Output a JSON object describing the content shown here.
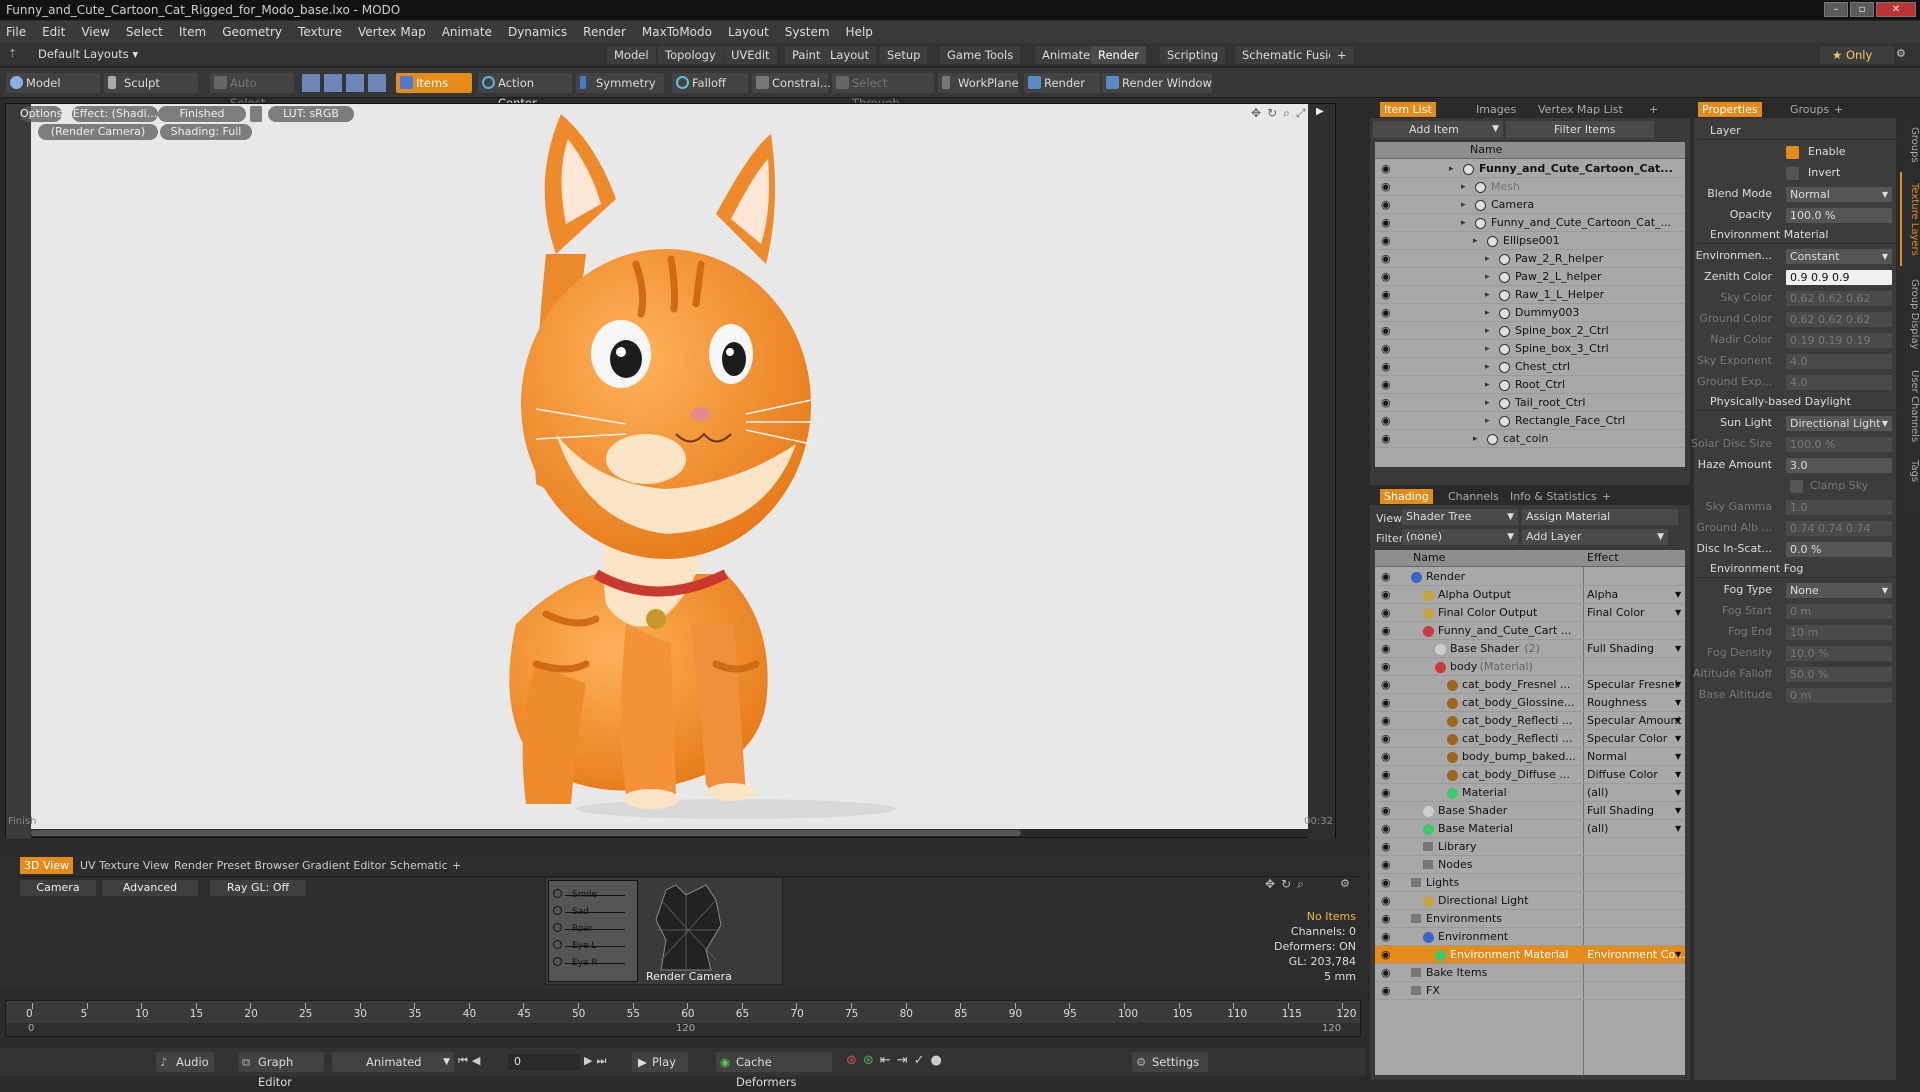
{
  "window": {
    "title": "Funny_and_Cute_Cartoon_Cat_Rigged_for_Modo_base.lxo - MODO"
  },
  "menu": [
    "File",
    "Edit",
    "View",
    "Select",
    "Item",
    "Geometry",
    "Texture",
    "Vertex Map",
    "Animate",
    "Dynamics",
    "Render",
    "MaxToModo",
    "Layout",
    "System",
    "Help"
  ],
  "layout": {
    "selector": "Default Layouts ▾",
    "tabs": [
      "Model",
      "Topology",
      "UVEdit",
      "Paint",
      "Layout",
      "Setup",
      "Game Tools",
      "Animate",
      "Render",
      "Scripting",
      "Schematic Fusion",
      "+"
    ],
    "active_tab": "Render",
    "only": "★ Only"
  },
  "toolbar": {
    "model": "Model",
    "sculpt": "Sculpt",
    "auto_select": "Auto Select",
    "items": "Items",
    "action_center": "Action Center",
    "symmetry": "Symmetry",
    "falloff": "Falloff",
    "constrain": "Constrai...",
    "select_through": "Select Through",
    "workplane": "WorkPlane",
    "render": "Render",
    "render_window": "Render Window"
  },
  "viewport": {
    "options": "Options",
    "effect": "Effect: (Shadi...",
    "finished": "Finished",
    "lut": "LUT: sRGB",
    "camera": "(Render Camera)",
    "shading": "Shading: Full",
    "status_left": "Finish",
    "status_right": "00:32"
  },
  "bottom": {
    "tabs": [
      "3D View",
      "UV Texture View",
      "Render Preset Browser",
      "Gradient Editor",
      "Schematic",
      "+"
    ],
    "active_tab": "3D View",
    "camera_btn": "Camera",
    "advanced_btn": "Advanced",
    "raygl_btn": "Ray GL: Off",
    "render_camera_label": "Render Camera",
    "schematic_labels": [
      "Smile",
      "Sad",
      "Roar",
      "Eye L",
      "Eye R"
    ],
    "info": {
      "no_items": "No Items",
      "channels": "Channels: 0",
      "deformers": "Deformers: ON",
      "gl": "GL: 203,784",
      "scale": "5 mm"
    }
  },
  "timeline": {
    "ticks": [
      "0",
      "5",
      "10",
      "15",
      "20",
      "25",
      "30",
      "35",
      "40",
      "45",
      "50",
      "55",
      "60",
      "65",
      "70",
      "75",
      "80",
      "85",
      "90",
      "95",
      "100",
      "105",
      "110",
      "115",
      "120"
    ],
    "sub_left": "0",
    "sub_mid": "120",
    "sub_right": "120"
  },
  "transport": {
    "audio": "Audio",
    "graph_editor": "Graph Editor",
    "animated": "Animated",
    "frame": "0",
    "play": "Play",
    "cache_deformers": "Cache Deformers",
    "settings": "Settings"
  },
  "itemlist": {
    "tabs": [
      "Item List",
      "Images",
      "Vertex Map List",
      "+"
    ],
    "add_item": "Add Item",
    "filter_items": "Filter Items",
    "col_name": "Name",
    "rows": [
      {
        "indent": 0,
        "label": "Funny_and_Cute_Cartoon_Cat...",
        "bold": true
      },
      {
        "indent": 1,
        "label": "Mesh",
        "dim": true
      },
      {
        "indent": 1,
        "label": "Camera"
      },
      {
        "indent": 1,
        "label": "Funny_and_Cute_Cartoon_Cat_..."
      },
      {
        "indent": 2,
        "label": "Ellipse001"
      },
      {
        "indent": 3,
        "label": "Paw_2_R_helper"
      },
      {
        "indent": 3,
        "label": "Paw_2_L_helper"
      },
      {
        "indent": 3,
        "label": "Raw_1_L_Helper"
      },
      {
        "indent": 3,
        "label": "Dummy003"
      },
      {
        "indent": 3,
        "label": "Spine_box_2_Ctrl"
      },
      {
        "indent": 3,
        "label": "Spine_box_3_Ctrl"
      },
      {
        "indent": 3,
        "label": "Chest_ctrl"
      },
      {
        "indent": 3,
        "label": "Root_Ctrl"
      },
      {
        "indent": 3,
        "label": "Tail_root_Ctrl"
      },
      {
        "indent": 3,
        "label": "Rectangle_Face_Ctrl"
      },
      {
        "indent": 2,
        "label": "cat_coin"
      }
    ]
  },
  "shading": {
    "tabs": [
      "Shading",
      "Channels",
      "Info & Statistics",
      "+"
    ],
    "view_label": "View",
    "view_value": "Shader Tree",
    "assign_material": "Assign Material",
    "filter_label": "Filter",
    "filter_value": "(none)",
    "add_layer": "Add Layer",
    "col_name": "Name",
    "col_effect": "Effect",
    "rows": [
      {
        "indent": 0,
        "label": "Render",
        "effect": "",
        "c": "#3b62c9"
      },
      {
        "indent": 1,
        "label": "Alpha Output",
        "effect": "Alpha",
        "c": "#c9a13b"
      },
      {
        "indent": 1,
        "label": "Final Color Output",
        "effect": "Final Color",
        "c": "#c9a13b"
      },
      {
        "indent": 1,
        "label": "Funny_and_Cute_Cart ...",
        "effect": "",
        "c": "#c93b3b"
      },
      {
        "indent": 2,
        "label": "Base Shader",
        "extra": "(2)",
        "effect": "Full Shading",
        "c": "#cfcfcf"
      },
      {
        "indent": 2,
        "label": "body",
        "extra": "(Material)",
        "effect": "",
        "c": "#c93b3b"
      },
      {
        "indent": 3,
        "label": "cat_body_Fresnel ...",
        "effect": "Specular Fresnel",
        "c": "#a0651d"
      },
      {
        "indent": 3,
        "label": "cat_body_Glossine...",
        "effect": "Roughness",
        "c": "#a0651d"
      },
      {
        "indent": 3,
        "label": "cat_body_Reflecti ...",
        "effect": "Specular Amount",
        "c": "#a0651d"
      },
      {
        "indent": 3,
        "label": "cat_body_Reflecti ...",
        "effect": "Specular Color",
        "c": "#a0651d"
      },
      {
        "indent": 3,
        "label": "body_bump_baked...",
        "effect": "Normal",
        "c": "#a0651d"
      },
      {
        "indent": 3,
        "label": "cat_body_Diffuse ...",
        "effect": "Diffuse Color",
        "c": "#a0651d"
      },
      {
        "indent": 3,
        "label": "Material",
        "effect": "(all)",
        "c": "#3bc96a"
      },
      {
        "indent": 1,
        "label": "Base Shader",
        "effect": "Full Shading",
        "c": "#cfcfcf"
      },
      {
        "indent": 1,
        "label": "Base Material",
        "effect": "(all)",
        "c": "#3bc96a"
      },
      {
        "indent": 1,
        "label": "Library",
        "effect": "",
        "c": ""
      },
      {
        "indent": 1,
        "label": "Nodes",
        "effect": "",
        "c": ""
      },
      {
        "indent": 0,
        "label": "Lights",
        "effect": "",
        "c": ""
      },
      {
        "indent": 1,
        "label": "Directional Light",
        "effect": "",
        "c": "#c9a13b"
      },
      {
        "indent": 0,
        "label": "Environments",
        "effect": "",
        "c": ""
      },
      {
        "indent": 1,
        "label": "Environment",
        "effect": "",
        "c": "#3b62c9"
      },
      {
        "indent": 2,
        "label": "Environment Material",
        "effect": "Environment Co...",
        "c": "#3bc96a",
        "selected": true
      },
      {
        "indent": 0,
        "label": "Bake Items",
        "effect": "",
        "c": ""
      },
      {
        "indent": 0,
        "label": "FX",
        "effect": "",
        "c": ""
      }
    ]
  },
  "properties": {
    "tabs": [
      "Properties",
      "Groups",
      "+"
    ],
    "layer": "Layer",
    "enable": "Enable",
    "invert": "Invert",
    "blend_mode": "Blend Mode",
    "blend_value": "Normal",
    "opacity": "Opacity",
    "opacity_value": "100.0 %",
    "env_material": "Environment Material",
    "environment": "Environmen...",
    "environment_value": "Constant",
    "zenith": "Zenith Color",
    "zenith_value": "0.9   0.9   0.9",
    "sky": "Sky Color",
    "sky_value": "0.62  0.62  0.62",
    "ground": "Ground Color",
    "ground_value": "0.62  0.62  0.62",
    "nadir": "Nadir Color",
    "nadir_value": "0.19  0.19  0.19",
    "sky_exp": "Sky Exponent",
    "sky_exp_value": "4.0",
    "ground_exp": "Ground Exp...",
    "ground_exp_value": "4.0",
    "daylight": "Physically-based Daylight",
    "sun_light": "Sun Light",
    "sun_light_value": "Directional Light",
    "solar_disc": "Solar Disc Size",
    "solar_disc_value": "100.0 %",
    "haze": "Haze Amount",
    "haze_value": "3.0",
    "clamp": "Clamp Sky Brig...",
    "sky_gamma": "Sky Gamma",
    "sky_gamma_value": "1.0",
    "ground_alb": "Ground Alb ...",
    "ground_alb_value": "0.74  0.74  0.74",
    "disc_scat": "Disc In-Scat...",
    "disc_scat_value": "0.0 %",
    "env_fog": "Environment Fog",
    "fog_type": "Fog Type",
    "fog_type_value": "None",
    "fog_start": "Fog Start",
    "fog_start_value": "0 m",
    "fog_end": "Fog End",
    "fog_end_value": "10 m",
    "fog_density": "Fog Density",
    "fog_density_value": "10.0 %",
    "alt_falloff": "Altitude Falloff",
    "alt_falloff_value": "50.0 %",
    "base_alt": "Base Altitude",
    "base_alt_value": "0 m"
  },
  "side_tabs": [
    "Groups",
    "Texture Layers",
    "Group Display",
    "User Channels",
    "Tags"
  ]
}
